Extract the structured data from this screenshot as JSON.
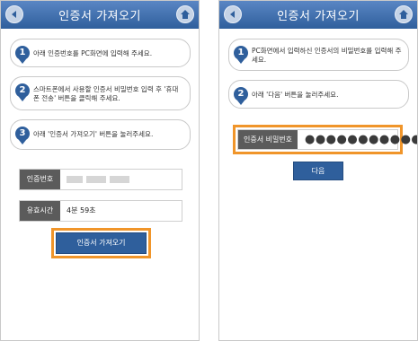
{
  "left_screen": {
    "title": "인증서 가져오기",
    "steps": [
      {
        "number": "1",
        "text": "아래 인증번호를 PC화면에 입력해 주세요."
      },
      {
        "number": "2",
        "text": "스마트폰에서 사용할 인증서 비밀번호 입력 후 '휴대폰 전송' 버튼을 클릭해 주세요."
      },
      {
        "number": "3",
        "text": "아래 '인증서 가져오기' 버튼을 눌러주세요."
      }
    ],
    "auth_label": "인증번호",
    "validity_label": "유효시간",
    "validity_value": "4분 59초",
    "import_button": "인증서 가져오기"
  },
  "right_screen": {
    "title": "인증서 가져오기",
    "steps": [
      {
        "number": "1",
        "text": "PC화면에서 입력하신 인증서의 비밀번호를 입력해 주세요."
      },
      {
        "number": "2",
        "text": "아래 '다음' 버튼을 눌러주세요."
      }
    ],
    "password_label": "인증서 비밀번호",
    "password_mask": "●●●●●●●●●●●",
    "next_button": "다음"
  },
  "colors": {
    "header": "#2f5f9c",
    "accent": "#2f5f9c",
    "highlight": "#f0952a",
    "label_bg": "#5b5b5b"
  },
  "icons": {
    "back": "back-arrow-icon",
    "home": "home-icon"
  }
}
